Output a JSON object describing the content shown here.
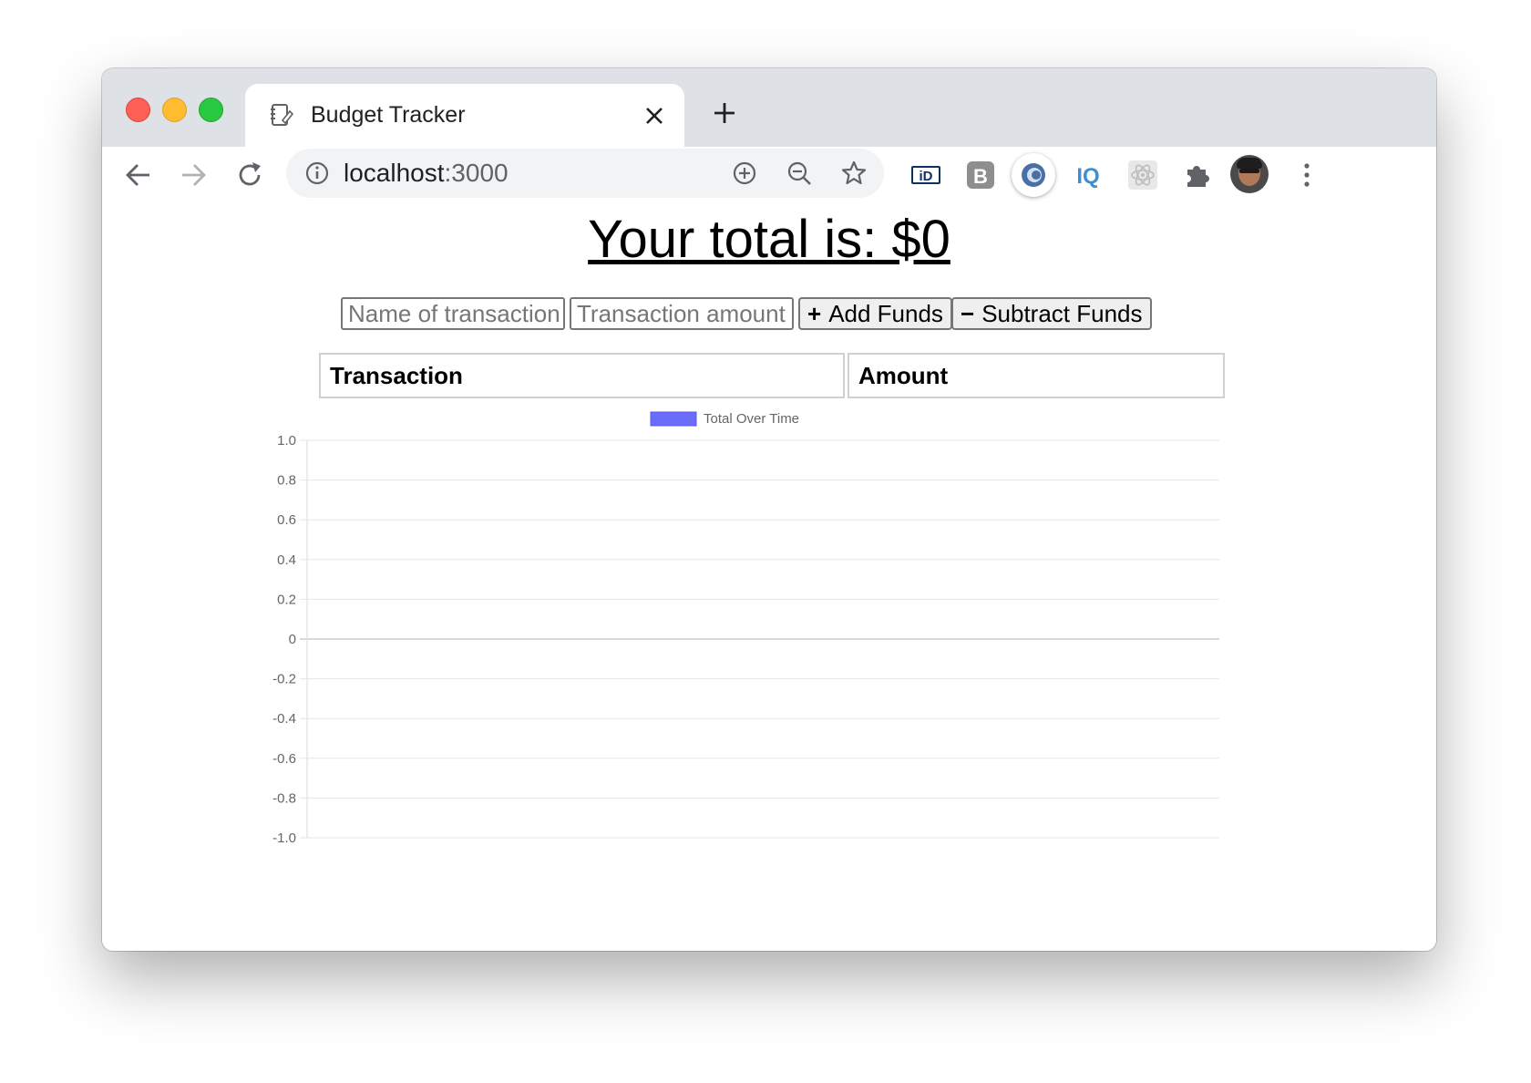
{
  "browser": {
    "tab_title": "Budget Tracker",
    "url_host": "localhost",
    "url_port": ":3000",
    "extensions": [
      "id-extension-icon",
      "b-extension-icon",
      "circle-extension-icon",
      "iq-extension-icon",
      "react-extension-icon",
      "puzzle-icon",
      "avatar",
      "more-icon"
    ]
  },
  "page": {
    "total_text": "Your total is: $0",
    "name_placeholder": "Name of transaction",
    "amount_placeholder": "Transaction amount",
    "add_button": "Add Funds",
    "add_symbol": "+",
    "subtract_button": "Subtract Funds",
    "subtract_symbol": "−",
    "table_headers": [
      "Transaction",
      "Amount"
    ]
  },
  "colors": {
    "legend_fill": "#6b6cfa",
    "grid": "#e6e6e6"
  },
  "chart_data": {
    "type": "line",
    "series": [
      {
        "name": "Total Over Time",
        "values": []
      }
    ],
    "categories": [],
    "ylim": [
      -1.0,
      1.0
    ],
    "yticks": [
      "1.0",
      "0.8",
      "0.6",
      "0.4",
      "0.2",
      "0",
      "-0.2",
      "-0.4",
      "-0.6",
      "-0.8",
      "-1.0"
    ],
    "legend": "top-center",
    "grid": true
  }
}
